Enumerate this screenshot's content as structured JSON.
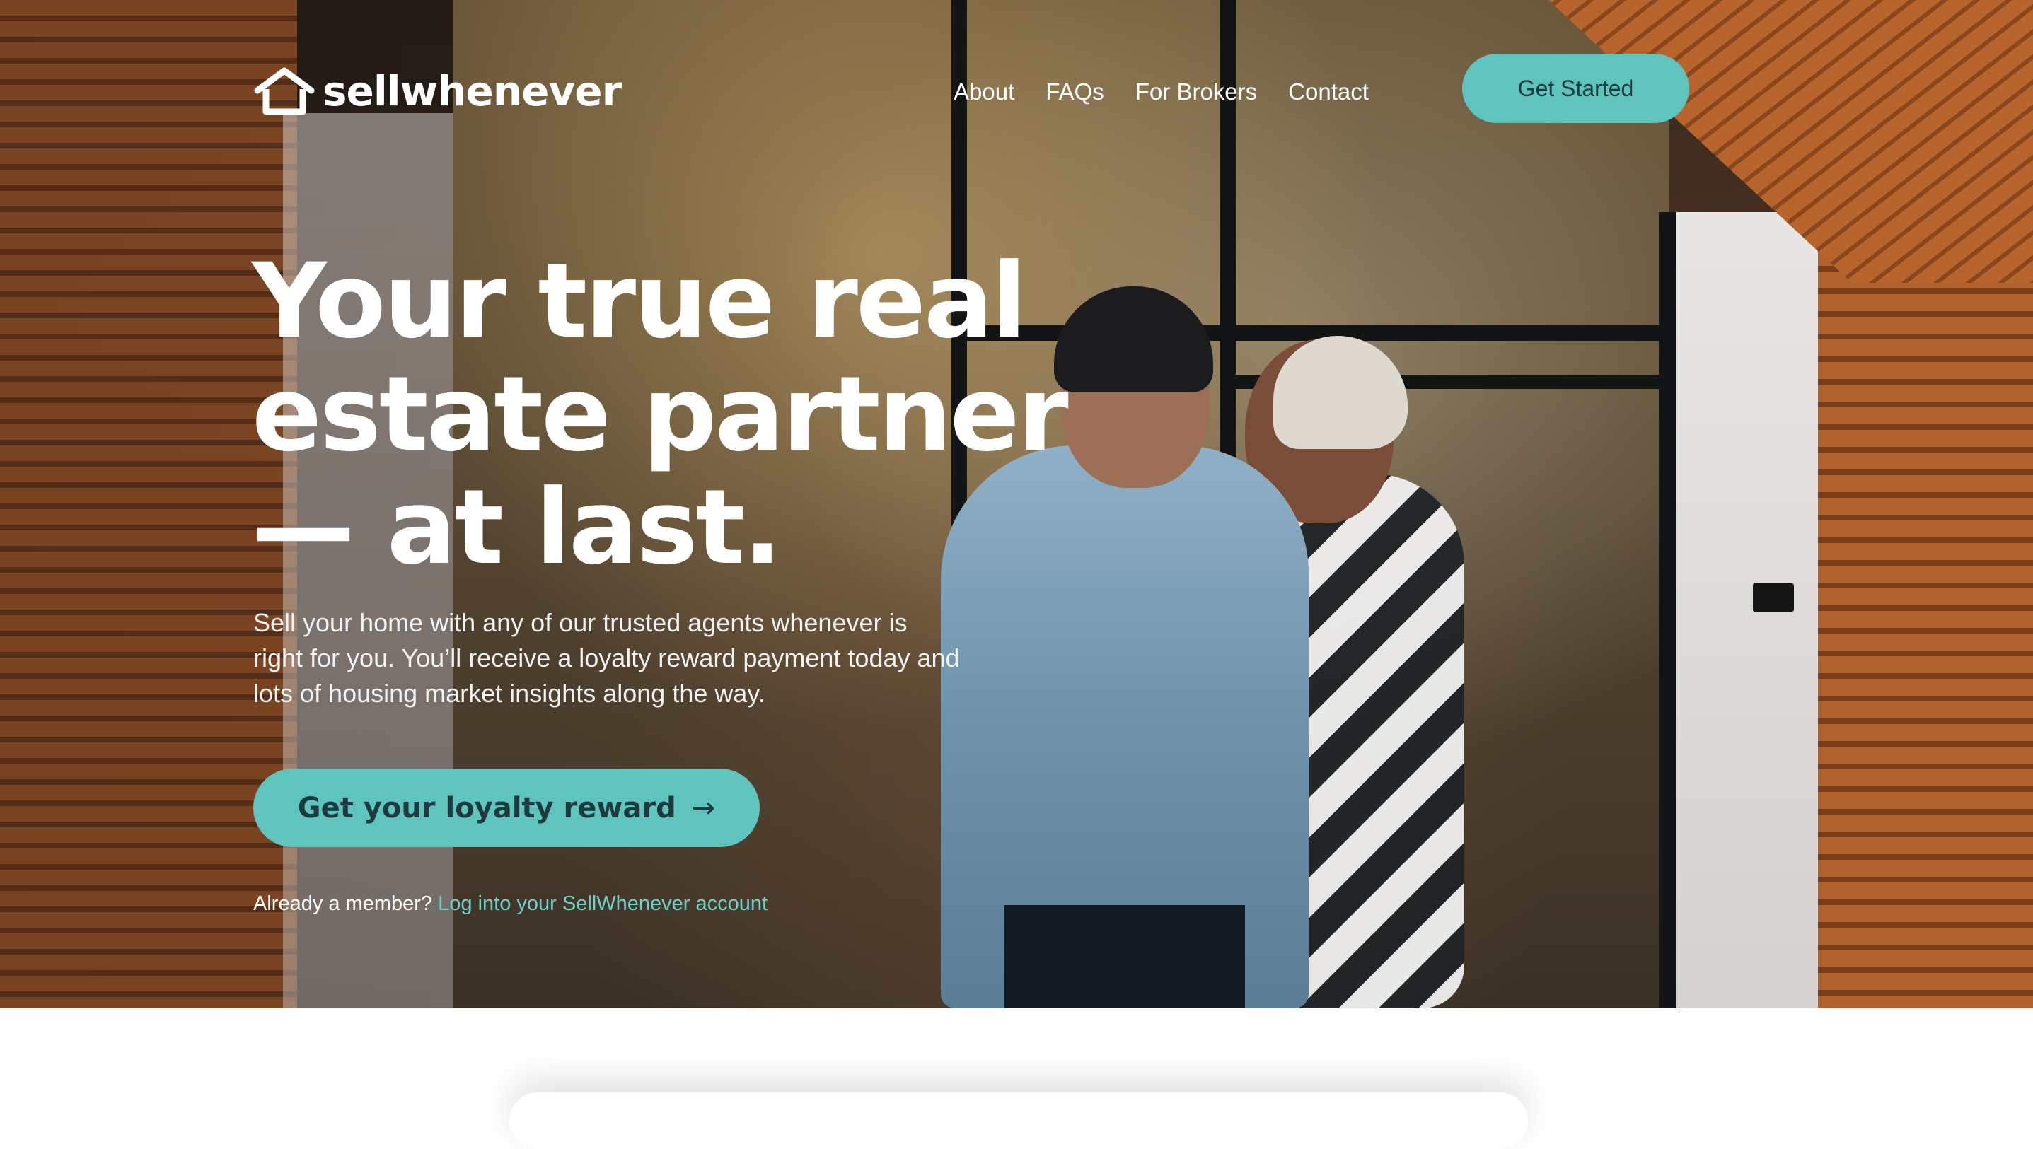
{
  "brand": {
    "name": "sellwhenever",
    "logo_icon": "house-outline-icon"
  },
  "nav": {
    "links": [
      "About",
      "FAQs",
      "For Brokers",
      "Contact"
    ],
    "cta_label": "Get Started"
  },
  "hero": {
    "headline_lines": [
      "Your true real",
      "estate partner",
      "— at last."
    ],
    "subcopy": "Sell your home with any of our trusted agents whenever is right for you. You’ll receive a loyalty reward payment today and lots of housing market insights along the way.",
    "cta_label": "Get your loyalty reward",
    "cta_icon": "arrow-right-icon",
    "member_prompt": "Already a member?",
    "member_link": "Log into your SellWhenever account"
  },
  "colors": {
    "accent": "#5ec4bd",
    "accent_text": "#1d3b3f",
    "link": "#6fd0c8"
  }
}
